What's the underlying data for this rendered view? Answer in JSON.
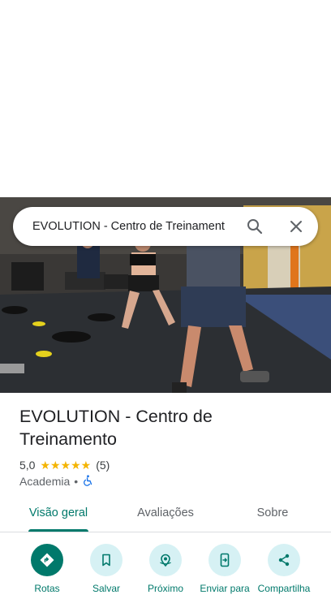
{
  "search": {
    "query": "EVOLUTION - Centro de Treinament"
  },
  "place": {
    "name": "EVOLUTION - Centro de Treinamento",
    "rating": "5,0",
    "stars": "★★★★★",
    "reviews_count": "(5)",
    "category": "Academia",
    "separator": "•"
  },
  "tabs": [
    {
      "label": "Visão geral",
      "active": true
    },
    {
      "label": "Avaliações",
      "active": false
    },
    {
      "label": "Sobre",
      "active": false
    }
  ],
  "actions": [
    {
      "label": "Rotas",
      "icon": "directions-icon"
    },
    {
      "label": "Salvar",
      "icon": "bookmark-icon"
    },
    {
      "label": "Próximo",
      "icon": "nearby-icon"
    },
    {
      "label": "Enviar para",
      "icon": "send-to-phone-icon"
    },
    {
      "label": "Compartilha",
      "icon": "share-icon"
    }
  ],
  "colors": {
    "accent": "#00796b",
    "button_bg": "#d6f1f4",
    "star": "#f4b400",
    "accessible_icon": "#1a73e8"
  }
}
